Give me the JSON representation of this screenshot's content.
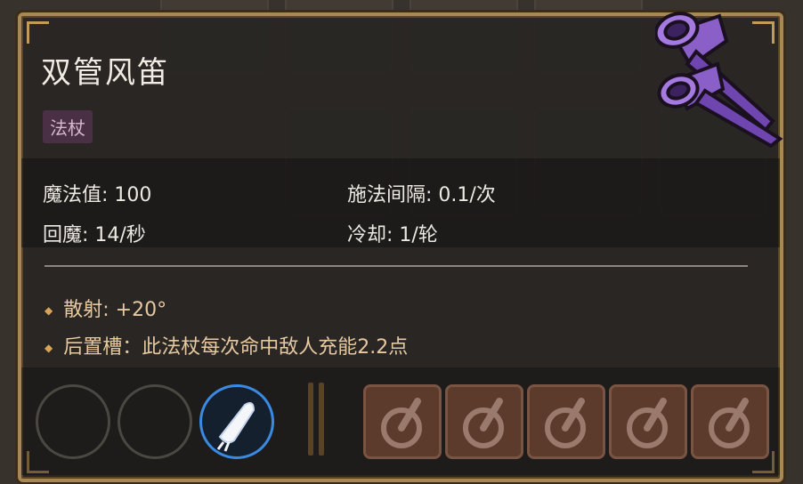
{
  "item": {
    "name": "双管风笛",
    "tag": "法杖",
    "icon": "purple-double-horn-icon"
  },
  "stats": {
    "mana": "魔法值: 100",
    "cast_interval": "施法间隔: 0.1/次",
    "mana_regen": "回魔: 14/秒",
    "cooldown": "冷却: 1/轮"
  },
  "effects": [
    "散射: +20°",
    "后置槽：此法杖每次命中敌人充能2.2点"
  ],
  "slots": {
    "front": [
      {
        "name": "empty-slot",
        "filled": false
      },
      {
        "name": "empty-slot",
        "filled": false
      },
      {
        "name": "white-bolt-spell-icon",
        "filled": true
      }
    ],
    "rear": [
      {
        "name": "rear-slot-icon"
      },
      {
        "name": "rear-slot-icon"
      },
      {
        "name": "rear-slot-icon"
      },
      {
        "name": "rear-slot-icon"
      },
      {
        "name": "rear-slot-icon"
      }
    ]
  },
  "colors": {
    "frame": "#a88856",
    "active_slot": "#3b8ae0",
    "bullet": "#d9a458",
    "tag_bg": "#4a3044"
  }
}
